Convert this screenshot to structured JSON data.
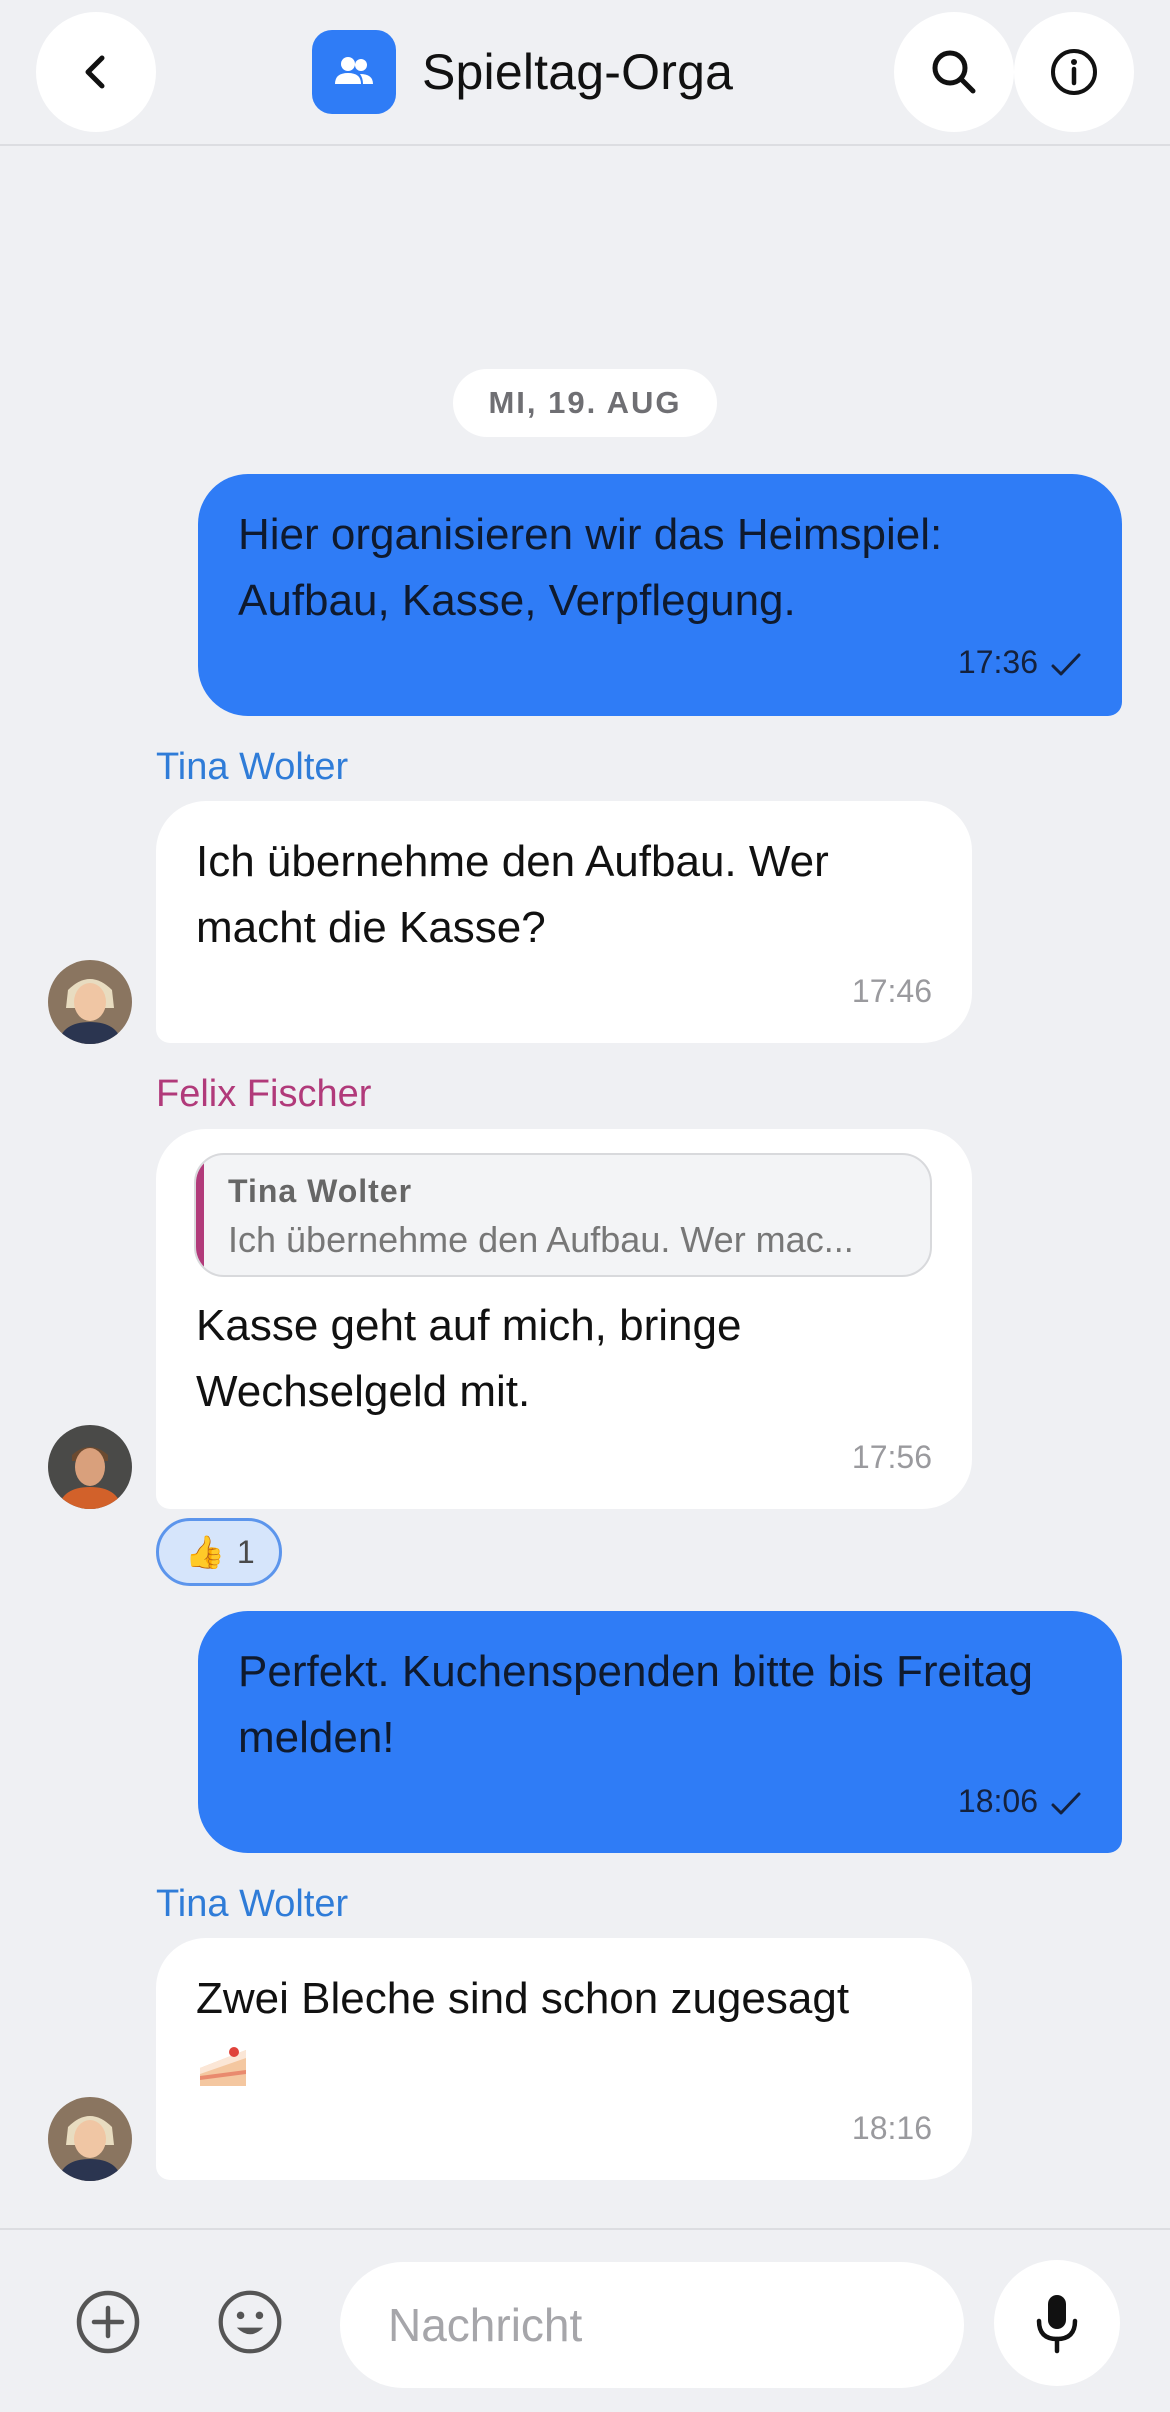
{
  "header": {
    "title": "Spieltag-Orga",
    "back_icon": "chevron-left-icon",
    "group_icon": "people-icon",
    "search_icon": "search-icon",
    "info_icon": "info-icon",
    "accent": "#2f7cf6"
  },
  "date_divider": "MI, 19. AUG",
  "messages": [
    {
      "direction": "out",
      "text": "Hier organisieren wir das Heimspiel: Aufbau, Kasse, Verpflegung.",
      "time": "17:36",
      "status": "sent"
    },
    {
      "direction": "in",
      "sender": "Tina Wolter",
      "text": "Ich übernehme den Aufbau. Wer macht die Kasse?",
      "time": "17:46"
    },
    {
      "direction": "in",
      "sender": "Felix Fischer",
      "reply_to": {
        "sender": "Tina Wolter",
        "text": "Ich übernehme den Aufbau. Wer mac..."
      },
      "text": "Kasse geht auf mich, bringe Wechselgeld mit.",
      "time": "17:56",
      "reaction": {
        "emoji": "👍",
        "count": "1"
      }
    },
    {
      "direction": "out",
      "text": "Perfekt. Kuchenspenden bitte bis Freitag melden!",
      "time": "18:06",
      "status": "sent"
    },
    {
      "direction": "in",
      "sender": "Tina Wolter",
      "text": "Zwei Bleche sind schon zugesagt",
      "emoji": "cake-icon",
      "time": "18:16"
    }
  ],
  "composer": {
    "placeholder": "Nachricht",
    "attach_icon": "plus-circle-icon",
    "emoji_icon": "smiley-icon",
    "mic_icon": "microphone-icon"
  },
  "colors": {
    "outgoing_bubble": "#2f7cf6",
    "incoming_bubble": "#ffffff",
    "background": "#eff0f3",
    "sender_tina": "#2f7cd8",
    "sender_felix": "#b13a7a"
  }
}
